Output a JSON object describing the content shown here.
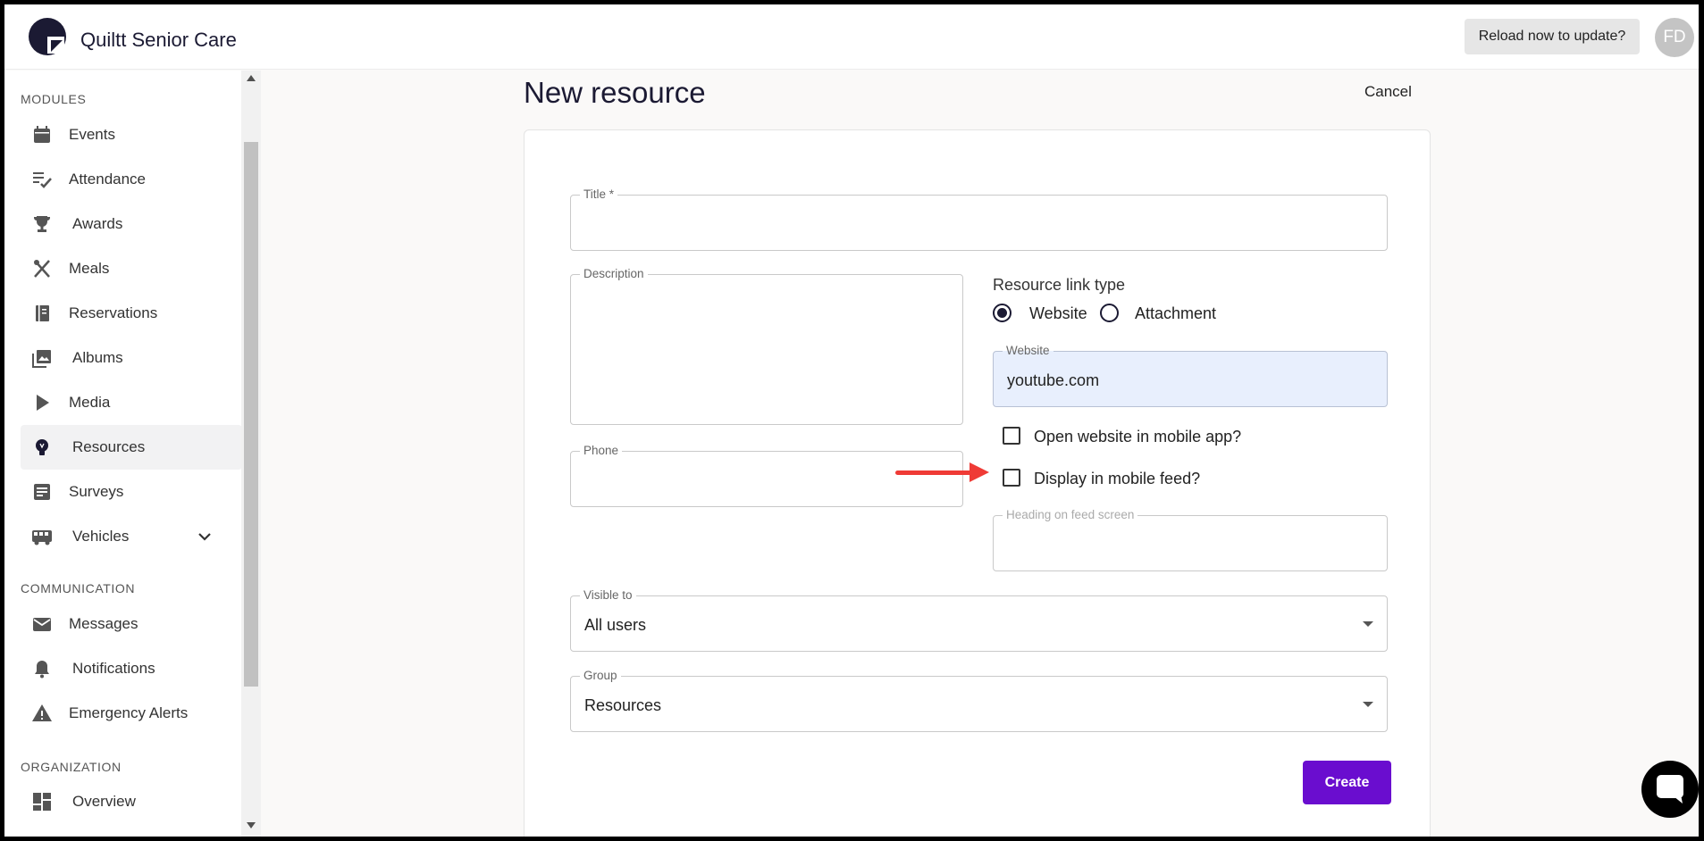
{
  "header": {
    "app_title": "Quiltt Senior Care",
    "reload_label": "Reload now to update?",
    "avatar_initials": "FD"
  },
  "sidebar": {
    "sections": [
      {
        "title": "MODULES"
      },
      {
        "title": "COMMUNICATION"
      },
      {
        "title": "ORGANIZATION"
      }
    ],
    "items": [
      {
        "label": "Events",
        "icon": "calendar-icon"
      },
      {
        "label": "Attendance",
        "icon": "checklist-icon"
      },
      {
        "label": "Awards",
        "icon": "trophy-icon"
      },
      {
        "label": "Meals",
        "icon": "utensils-icon"
      },
      {
        "label": "Reservations",
        "icon": "book-icon"
      },
      {
        "label": "Albums",
        "icon": "photo-album-icon"
      },
      {
        "label": "Media",
        "icon": "play-icon"
      },
      {
        "label": "Resources",
        "icon": "lightbulb-icon",
        "active": true
      },
      {
        "label": "Surveys",
        "icon": "survey-icon"
      },
      {
        "label": "Vehicles",
        "icon": "bus-icon",
        "expandable": true
      },
      {
        "label": "Messages",
        "icon": "mail-icon"
      },
      {
        "label": "Notifications",
        "icon": "bell-icon"
      },
      {
        "label": "Emergency Alerts",
        "icon": "warning-icon"
      },
      {
        "label": "Overview",
        "icon": "dashboard-icon"
      }
    ]
  },
  "main": {
    "page_title": "New resource",
    "cancel_label": "Cancel",
    "form": {
      "title_label": "Title *",
      "title_value": "",
      "description_label": "Description",
      "description_value": "",
      "phone_label": "Phone",
      "phone_value": "",
      "resource_link_type_label": "Resource link type",
      "link_options": [
        {
          "label": "Website",
          "selected": true
        },
        {
          "label": "Attachment",
          "selected": false
        }
      ],
      "website_label": "Website",
      "website_value": "youtube.com",
      "open_in_app_label": "Open website in mobile app?",
      "open_in_app_checked": false,
      "display_in_feed_label": "Display in mobile feed?",
      "display_in_feed_checked": false,
      "heading_label": "Heading on feed screen",
      "heading_value": "",
      "visible_to_label": "Visible to",
      "visible_to_value": "All users",
      "group_label": "Group",
      "group_value": "Resources",
      "create_label": "Create"
    }
  },
  "colors": {
    "primary": "#6a0dcf",
    "navy": "#1b1a33",
    "annotation_arrow": "#ef3b36",
    "autofill_bg": "#e8effd"
  }
}
